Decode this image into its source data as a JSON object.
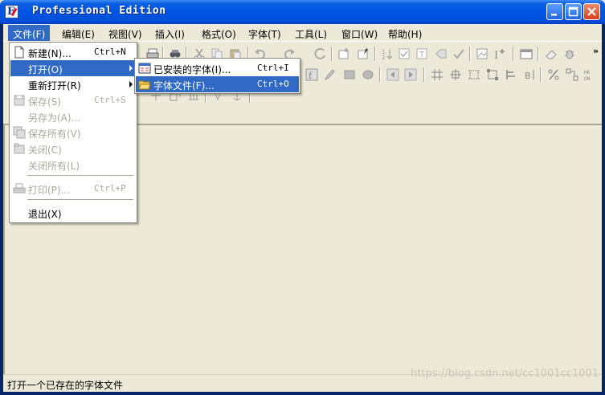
{
  "window": {
    "title": "Professional Edition"
  },
  "menubar": {
    "items": [
      "文件(F)",
      "编辑(E)",
      "视图(V)",
      "插入(I)",
      "格式(O)",
      "字体(T)",
      "工具(L)",
      "窗口(W)",
      "帮助(H)"
    ],
    "active_index": 0
  },
  "file_menu": {
    "items": [
      {
        "label": "新建(N)...",
        "shortcut": "Ctrl+N",
        "state": "enabled",
        "icon": "new-document-icon"
      },
      {
        "label": "打开(O)",
        "shortcut": "",
        "state": "highlighted",
        "submenu": true
      },
      {
        "label": "重新打开(R)",
        "shortcut": "",
        "state": "enabled",
        "submenu": true
      },
      {
        "label": "保存(S)",
        "shortcut": "Ctrl+S",
        "state": "disabled",
        "icon": "save-icon"
      },
      {
        "label": "另存为(A)...",
        "shortcut": "",
        "state": "disabled"
      },
      {
        "label": "保存所有(V)",
        "shortcut": "",
        "state": "disabled",
        "icon": "save-all-icon"
      },
      {
        "label": "关闭(C)",
        "shortcut": "",
        "state": "disabled",
        "icon": "close-file-icon"
      },
      {
        "label": "关闭所有(L)",
        "shortcut": "",
        "state": "disabled"
      },
      {
        "label": "打印(P)...",
        "shortcut": "Ctrl+P",
        "state": "disabled",
        "icon": "print-icon"
      },
      {
        "label": "退出(X)",
        "shortcut": "",
        "state": "enabled"
      }
    ]
  },
  "open_submenu": {
    "items": [
      {
        "label": "已安装的字体(I)...",
        "shortcut": "Ctrl+I",
        "state": "enabled",
        "icon": "installed-fonts-icon"
      },
      {
        "label": "字体文件(F)...",
        "shortcut": "Ctrl+O",
        "state": "highlighted",
        "icon": "open-folder-icon"
      }
    ]
  },
  "status": {
    "text": "打开一个已存在的字体文件"
  },
  "watermark": "https://blog.csdn.net/cc1001cc1001",
  "colors": {
    "titlebar": "#0054e3",
    "highlight": "#316ac5",
    "face": "#ece9d8",
    "disabled": "#aca899"
  }
}
